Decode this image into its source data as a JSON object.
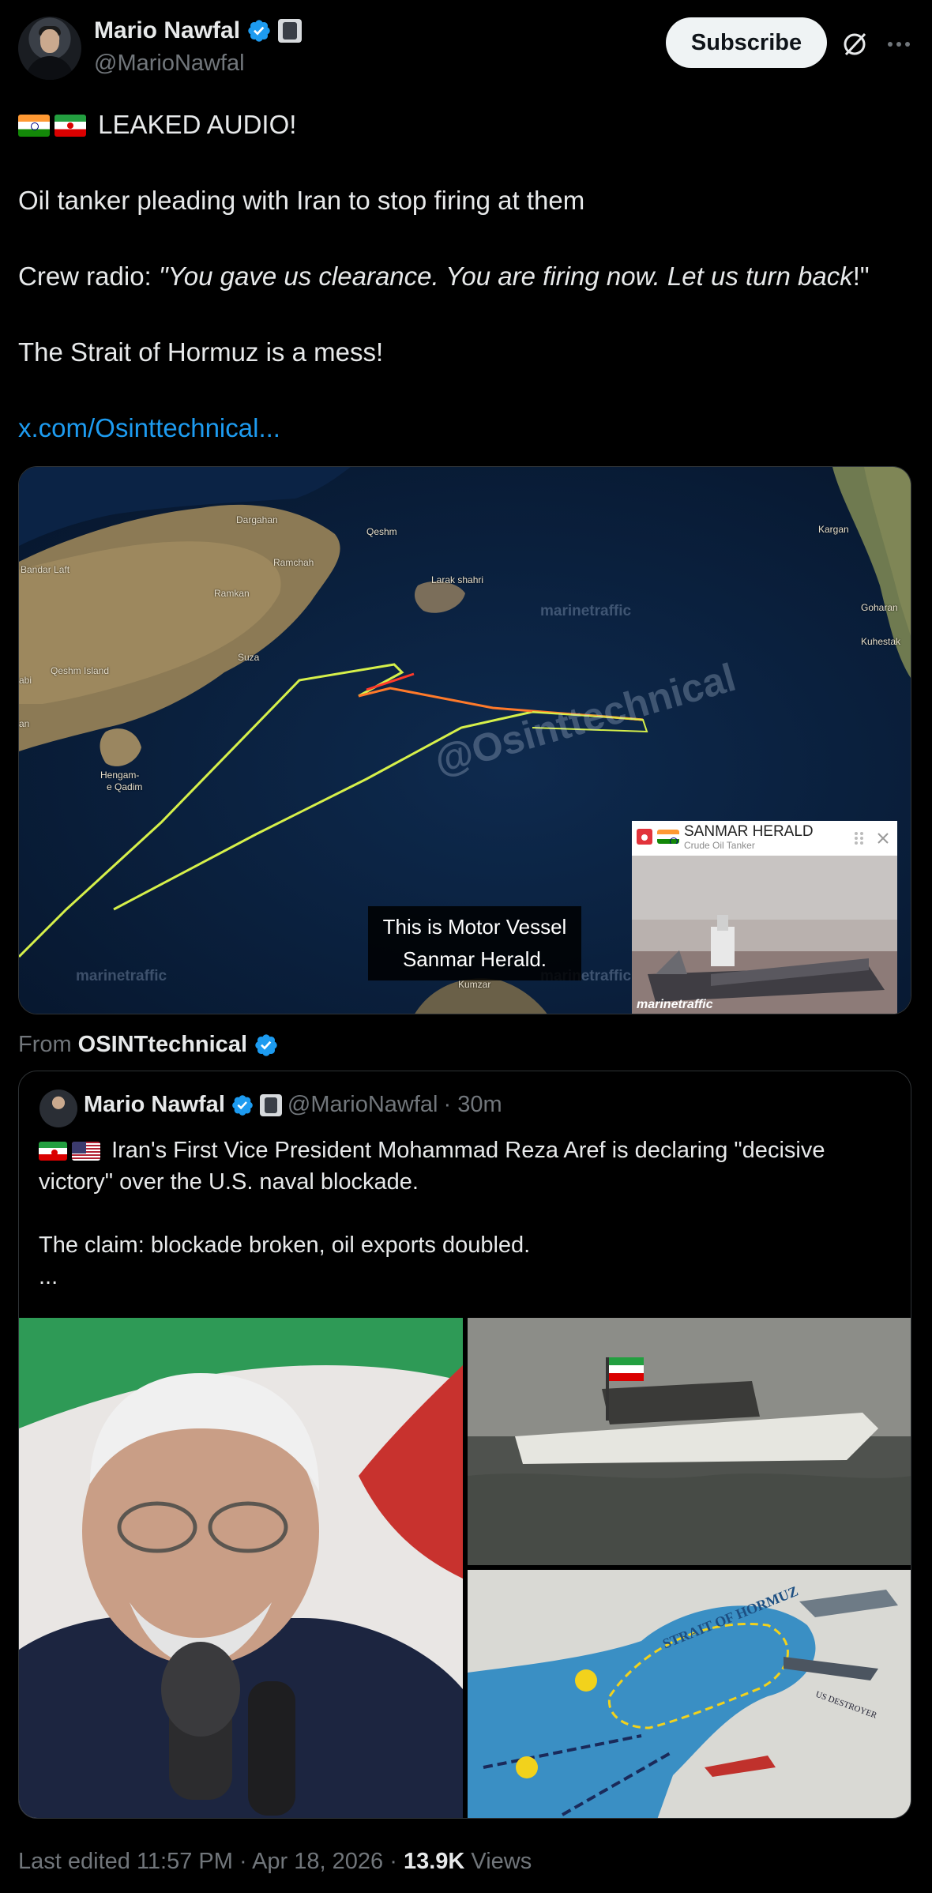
{
  "author": {
    "display_name": "Mario Nawfal",
    "handle": "@MarioNawfal"
  },
  "actions": {
    "subscribe_label": "Subscribe"
  },
  "tweet": {
    "line1": "LEAKED AUDIO!",
    "line2": "Oil tanker pleading with Iran to stop firing at them",
    "line3_prefix": "Crew radio: ",
    "line3_quote": "\"You gave us clearance. You are firing now. Let us turn back",
    "line3_suffix": "!\"",
    "line4": "The Strait of Hormuz is a mess!",
    "link": "x.com/Osinttechnical..."
  },
  "map": {
    "caption_line1": "This is Motor Vessel",
    "caption_line2": "Sanmar Herald.",
    "places": [
      "Dargahan",
      "Qeshm",
      "Ramchah",
      "Ramkan",
      "Bandar Laft",
      "Larak shahri",
      "Suza",
      "Qeshm Island",
      "Hengam-",
      "e Qadim",
      "Kargan",
      "Goharan",
      "Kuhestak",
      "Kumzar",
      "abi",
      "an"
    ],
    "watermark_site": "marinetraffic",
    "watermark_account": "@Osinttechnical",
    "vessel": {
      "name": "SANMAR HERALD",
      "type": "Crude Oil Tanker",
      "photo_watermark": "marinetraffic"
    }
  },
  "source": {
    "prefix": "From ",
    "account": "OSINTtechnical"
  },
  "quoted": {
    "display_name": "Mario Nawfal",
    "handle": "@MarioNawfal",
    "time": "· 30m",
    "text_line1": "Iran's First Vice President Mohammad Reza Aref is declaring \"decisive",
    "text_line2": "victory\" over the U.S. naval blockade.",
    "text_line3": "The claim: blockade broken, oil exports doubled.",
    "text_line4": "...",
    "map_title": "STRAIT OF HORMUZ",
    "map_ship_label": "US DESTROYER"
  },
  "footer": {
    "edited": "Last edited 11:57 PM · Apr 18, 2026 · ",
    "views_count": "13.9K",
    "views_label": " Views"
  },
  "colors": {
    "accent": "#1d9bf0",
    "background": "#000000",
    "track_green": "#d6f04a",
    "track_red": "#ff5a2a"
  }
}
